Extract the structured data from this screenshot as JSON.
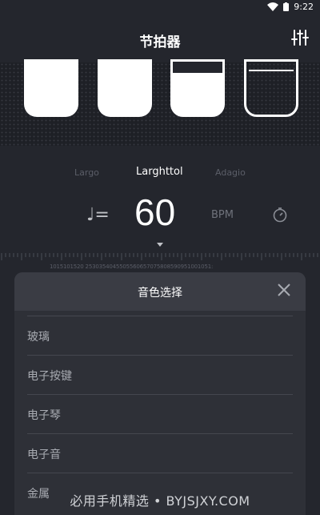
{
  "status_bar": {
    "time": "9:22"
  },
  "header": {
    "title": "节拍器"
  },
  "beats": [
    {
      "state": "filled"
    },
    {
      "state": "filled"
    },
    {
      "state": "partial"
    },
    {
      "state": "empty"
    }
  ],
  "tempo": {
    "names": [
      "Largo",
      "Larghttol",
      "Adagio"
    ],
    "selected": "Larghttol",
    "bpm": "60",
    "unit": "BPM",
    "note_symbol": "♩="
  },
  "ruler": {
    "labels": "1015101520 2530354045505560657075808590951001051:"
  },
  "modal": {
    "title": "音色选择",
    "options": [
      "玻璃",
      "电子按键",
      "电子琴",
      "电子音",
      "金属"
    ]
  },
  "watermark": "必用手机精选 • BYJSJXY.COM",
  "colors": {
    "background": "#24262d",
    "modal": "#2e3037",
    "text_muted": "#a8abb2"
  }
}
